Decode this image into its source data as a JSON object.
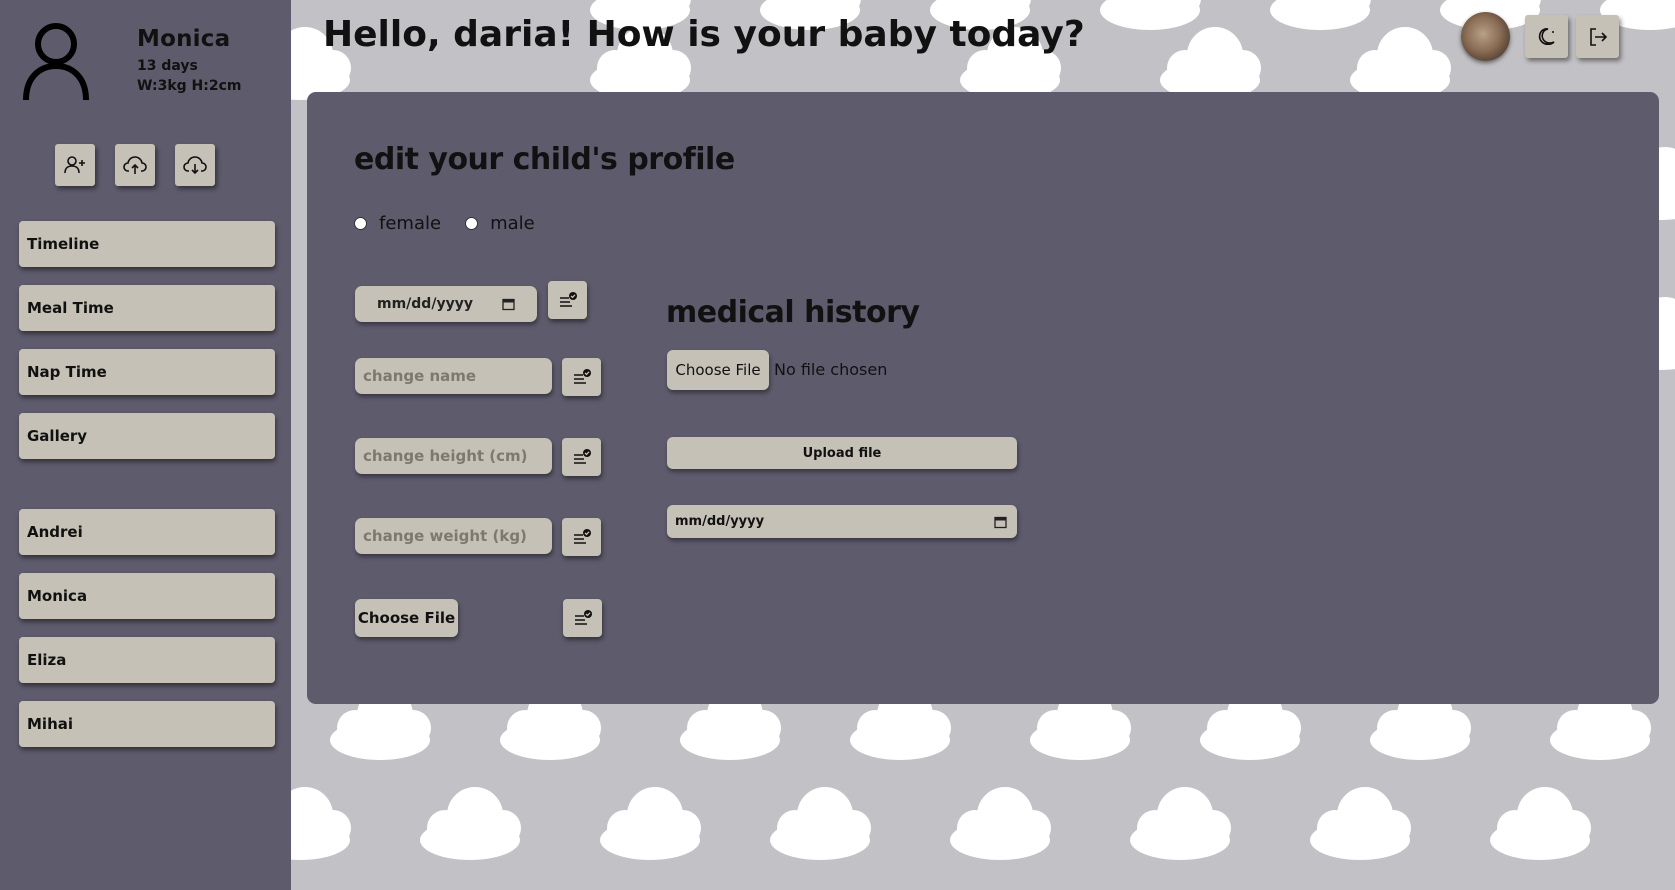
{
  "header": {
    "greeting": "Hello, daria! How is your baby today?"
  },
  "child": {
    "name": "Monica",
    "age": "13 days",
    "stats": "W:3kg H:2cm"
  },
  "sidebar": {
    "actions": [
      {
        "icon": "add-user-icon"
      },
      {
        "icon": "cloud-upload-icon"
      },
      {
        "icon": "cloud-download-icon"
      }
    ],
    "nav": [
      {
        "label": "Timeline"
      },
      {
        "label": "Meal Time"
      },
      {
        "label": "Nap Time"
      },
      {
        "label": "Gallery"
      }
    ],
    "children": [
      {
        "label": "Andrei"
      },
      {
        "label": "Monica"
      },
      {
        "label": "Eliza"
      },
      {
        "label": "Mihai"
      }
    ]
  },
  "profile_form": {
    "title": "edit your child's profile",
    "gender_options": [
      "female",
      "male"
    ],
    "birthdate_placeholder": "mm/dd/yyyy",
    "name_placeholder": "change name",
    "height_placeholder": "change height (cm)",
    "weight_placeholder": "change weight (kg)",
    "photo_button": "Choose File"
  },
  "medical_history": {
    "title": "medical history",
    "choose_file": "Choose File",
    "no_file": "No file chosen",
    "upload_button": "Upload file",
    "date_placeholder": "mm/dd/yyyy"
  },
  "top_actions": [
    {
      "icon": "moon-icon"
    },
    {
      "icon": "logout-icon"
    }
  ],
  "colors": {
    "sidebar_bg": "#5e5b6c",
    "page_bg": "#c2c1c5",
    "button_bg": "#c5c1b6",
    "cloud": "#ffffff"
  }
}
